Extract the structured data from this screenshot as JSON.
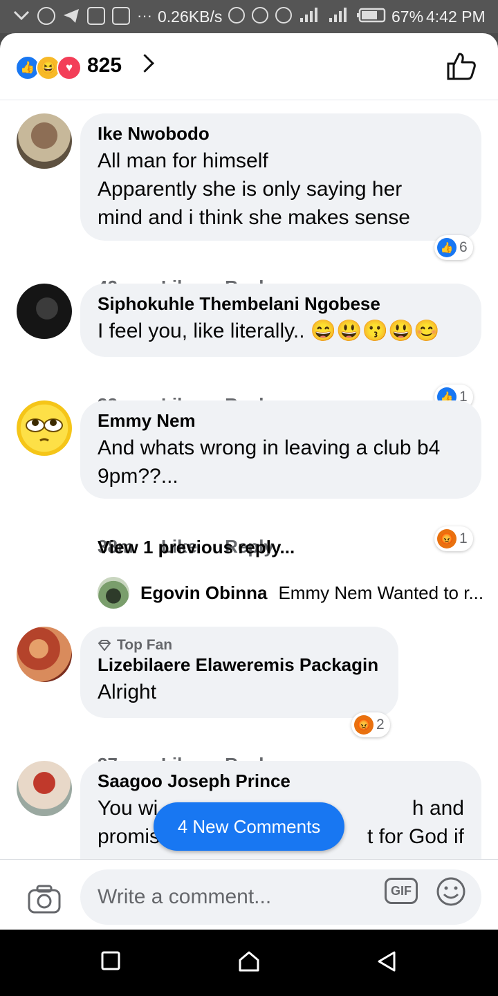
{
  "status_bar": {
    "network_speed": "0.26KB/s",
    "battery": "67%",
    "time": "4:42 PM"
  },
  "header": {
    "reaction_count": "825",
    "reaction_types": [
      "like-icon",
      "haha-icon",
      "love-icon"
    ]
  },
  "comments": [
    {
      "name": "Ike Nwobodo",
      "lines": [
        "All man for himself",
        "Apparently she is only saying her",
        "mind and i think she makes sense"
      ],
      "time": "42m",
      "like": "Like",
      "reply": "Reply",
      "reaction": {
        "type": "like-icon",
        "count": "6"
      }
    },
    {
      "name": "Siphokuhle Thembelani Ngobese",
      "lines": [
        "I feel you, like literally.. 😄😃😗😃😊"
      ],
      "time": "33m",
      "like": "Like",
      "reply": "Reply",
      "reaction": {
        "type": "like-icon",
        "count": "1"
      }
    },
    {
      "name": "Emmy Nem",
      "lines": [
        "And whats wrong in leaving a club b4",
        "9pm??..."
      ],
      "time": "38m",
      "like": "Like",
      "reply": "Reply",
      "reaction": {
        "type": "angry-icon",
        "count": "1"
      }
    },
    {
      "badge": "Top Fan",
      "name": "Lizebilaere Elaweremis Packagin",
      "lines": [
        "Alright"
      ],
      "time": "37m",
      "like": "Like",
      "reply": "Reply",
      "reaction": {
        "type": "angry-icon",
        "count": "2"
      }
    },
    {
      "name": "Saagoo Joseph Prince",
      "lines": [
        "You wi",
        "promis"
      ],
      "lines_right": [
        "h and",
        "t for God if"
      ]
    }
  ],
  "replies_thread": {
    "view_previous": "View 1 previous reply...",
    "reply_name": "Egovin Obinna",
    "reply_preview": "Emmy Nem Wanted to r..."
  },
  "new_comments_button": "4 New Comments",
  "composer": {
    "placeholder": "Write a comment...",
    "gif_label": "GIF"
  },
  "colors": {
    "accent": "#1877f2",
    "bubble": "#f0f2f5",
    "meta": "#65676b",
    "angry": "#e9710f"
  }
}
